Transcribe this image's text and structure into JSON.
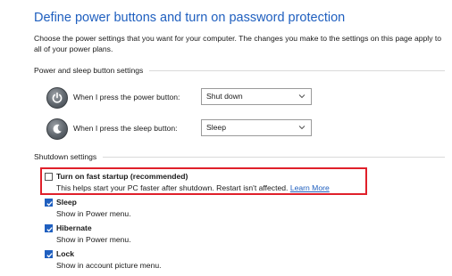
{
  "header": {
    "title": "Define power buttons and turn on password protection",
    "description": "Choose the power settings that you want for your computer. The changes you make to the settings on this page apply to all of your power plans."
  },
  "power_section": {
    "title": "Power and sleep button settings",
    "rows": [
      {
        "label": "When I press the power button:",
        "value": "Shut down",
        "icon": "power-icon"
      },
      {
        "label": "When I press the sleep button:",
        "value": "Sleep",
        "icon": "sleep-icon"
      }
    ]
  },
  "shutdown_section": {
    "title": "Shutdown settings",
    "items": [
      {
        "label": "Turn on fast startup (recommended)",
        "checked": false,
        "description": "This helps start your PC faster after shutdown. Restart isn't affected.",
        "link": "Learn More"
      },
      {
        "label": "Sleep",
        "checked": true,
        "description": "Show in Power menu."
      },
      {
        "label": "Hibernate",
        "checked": true,
        "description": "Show in Power menu."
      },
      {
        "label": "Lock",
        "checked": true,
        "description": "Show in account picture menu."
      }
    ]
  },
  "colors": {
    "accent": "#1f5fbf",
    "highlight": "#e0202a"
  }
}
